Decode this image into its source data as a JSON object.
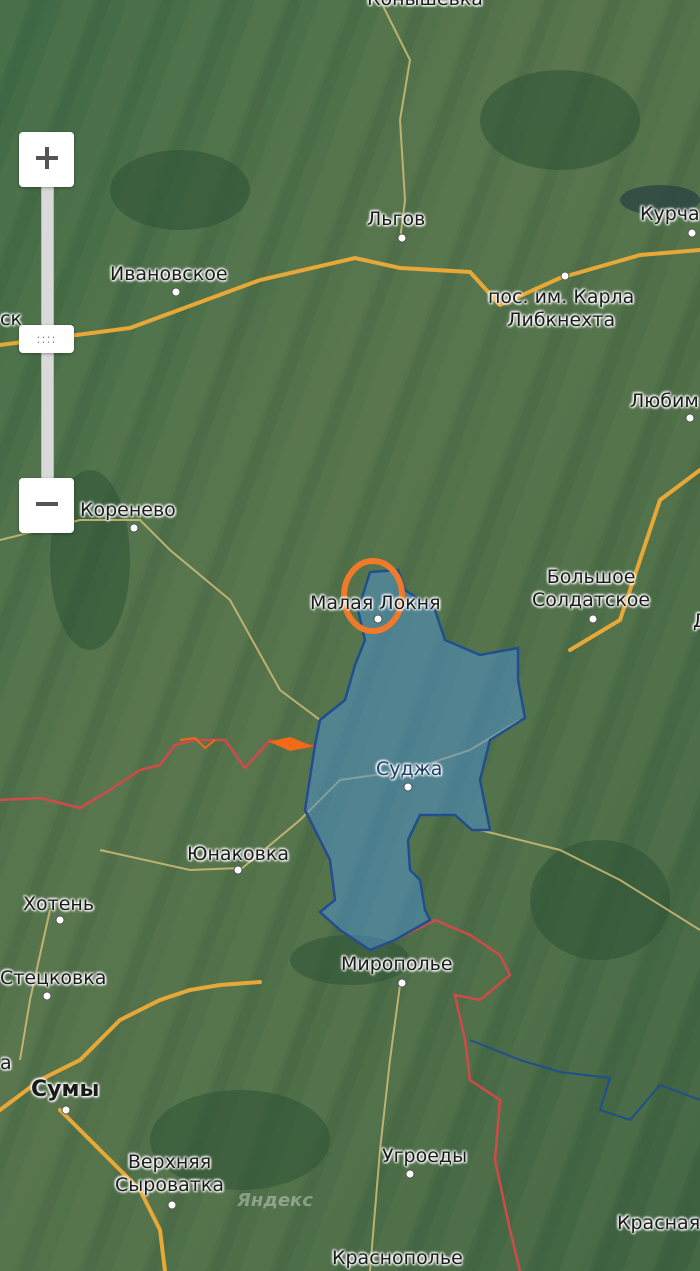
{
  "map": {
    "labels": {
      "konyshevka": "Конышевка",
      "lgov": "Льгов",
      "kurchatov": "Курча",
      "ivanovskoe": "Ивановское",
      "karla_libknehta_1": "пос. им. Карла",
      "karla_libknehta_2": "Либкнехта",
      "sk": "ск",
      "lyubim": "Любим",
      "korenevo": "Коренево",
      "malaya_lokhnya": "Малая Локня",
      "bolshoe_soldatskoe_1": "Большое",
      "bolshoe_soldatskoe_2": "Солдатское",
      "sudzha": "Суджа",
      "yunakovka": "Юнаковка",
      "khoten": "Хотень",
      "stetskovka": "Стецковка",
      "miropolye": "Миропольe",
      "sumy": "Сумы",
      "verkhnyaya_syrovatka_1": "Верхняя",
      "verkhnyaya_syrovatka_2": "Сыроватка",
      "ugroedy": "Угроеды",
      "krasnopolye": "Краснополье",
      "krasnaya": "Красная",
      "a_edge": "а",
      "d_edge": "Д"
    },
    "watermark": "Яндекс",
    "colors": {
      "road": "#e8a838",
      "border_red": "#d14a4a",
      "region_fill": "#4f8fc9",
      "region_stroke": "#1f4f8f",
      "highlight_circle": "#f07a2a",
      "border_orange": "#f06a1a"
    }
  },
  "controls": {
    "zoom_in_icon": "plus-icon",
    "zoom_out_icon": "minus-icon",
    "slider_grip": "::::"
  }
}
